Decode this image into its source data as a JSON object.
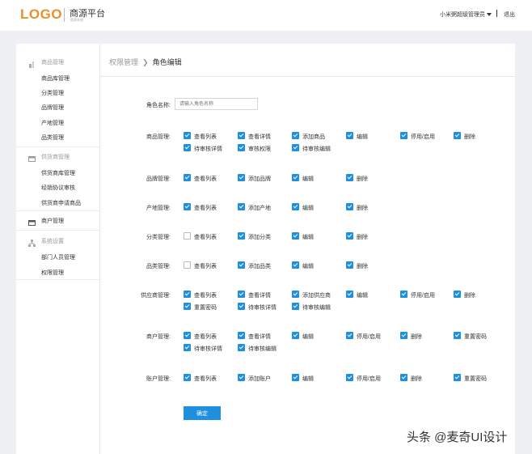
{
  "header": {
    "logo": "LOGO",
    "platform_title": "商源平台",
    "platform_subtitle": "商源系统",
    "user": "小米粥超级管理员",
    "logout": "退出"
  },
  "sidebar": {
    "groups": [
      {
        "label": "商品管理",
        "icon": "goods-icon",
        "items": [
          "商品库管理",
          "分类管理",
          "品牌管理",
          "产地管理",
          "品类管理"
        ]
      },
      {
        "label": "供货商管理",
        "icon": "supplier-icon",
        "items": [
          "供货商库管理",
          "经销协议审核",
          "供货商申请商品"
        ]
      },
      {
        "label": "商户管理",
        "icon": "merchant-icon",
        "items": []
      },
      {
        "label": "系统设置",
        "icon": "org-icon",
        "items": [
          "部门人员管理",
          "权限管理"
        ]
      }
    ]
  },
  "breadcrumb": {
    "parent": "权限管理",
    "current": "角色编辑"
  },
  "form": {
    "role_name_label": "角色名称:",
    "role_name_placeholder": "请输入角色名称",
    "submit": "确定"
  },
  "permissions": [
    {
      "label": "商品管理:",
      "options": [
        {
          "text": "查看列表",
          "checked": true
        },
        {
          "text": "查看详情",
          "checked": true
        },
        {
          "text": "添加商品",
          "checked": true
        },
        {
          "text": "编辑",
          "checked": true
        },
        {
          "text": "停用/启用",
          "checked": true
        },
        {
          "text": "删除",
          "checked": true
        },
        {
          "text": "待审核详情",
          "checked": true
        },
        {
          "text": "审核权限",
          "checked": true
        },
        {
          "text": "待审核编辑",
          "checked": true
        }
      ]
    },
    {
      "label": "品牌管理:",
      "options": [
        {
          "text": "查看列表",
          "checked": true
        },
        {
          "text": "添加品牌",
          "checked": true
        },
        {
          "text": "编辑",
          "checked": true
        },
        {
          "text": "删除",
          "checked": true
        }
      ]
    },
    {
      "label": "产地管理:",
      "options": [
        {
          "text": "查看列表",
          "checked": true
        },
        {
          "text": "添加产地",
          "checked": true
        },
        {
          "text": "编辑",
          "checked": true
        },
        {
          "text": "删除",
          "checked": true
        }
      ]
    },
    {
      "label": "分类管理:",
      "options": [
        {
          "text": "查看列表",
          "checked": false
        },
        {
          "text": "添加分类",
          "checked": true
        },
        {
          "text": "编辑",
          "checked": true
        },
        {
          "text": "删除",
          "checked": true
        }
      ]
    },
    {
      "label": "品类管理:",
      "options": [
        {
          "text": "查看列表",
          "checked": false
        },
        {
          "text": "添加品类",
          "checked": true
        },
        {
          "text": "编辑",
          "checked": true
        },
        {
          "text": "删除",
          "checked": true
        }
      ]
    },
    {
      "label": "供应商管理:",
      "options": [
        {
          "text": "查看列表",
          "checked": true
        },
        {
          "text": "查看详情",
          "checked": true
        },
        {
          "text": "添加供应商",
          "checked": true
        },
        {
          "text": "编辑",
          "checked": true
        },
        {
          "text": "停用/启用",
          "checked": true
        },
        {
          "text": "删除",
          "checked": true
        },
        {
          "text": "重置密码",
          "checked": true
        },
        {
          "text": "待审核详情",
          "checked": true
        },
        {
          "text": "待审核编辑",
          "checked": true
        }
      ]
    },
    {
      "label": "商户管理:",
      "options": [
        {
          "text": "查看列表",
          "checked": true
        },
        {
          "text": "查看详情",
          "checked": true
        },
        {
          "text": "编辑",
          "checked": true
        },
        {
          "text": "停用/启用",
          "checked": true
        },
        {
          "text": "删除",
          "checked": true
        },
        {
          "text": "重置密码",
          "checked": true
        },
        {
          "text": "待审核详情",
          "checked": true
        },
        {
          "text": "待审核编辑",
          "checked": true
        }
      ]
    },
    {
      "label": "账户管理:",
      "options": [
        {
          "text": "查看列表",
          "checked": true
        },
        {
          "text": "添加账户",
          "checked": true
        },
        {
          "text": "编辑",
          "checked": true
        },
        {
          "text": "停用/启用",
          "checked": true
        },
        {
          "text": "删除",
          "checked": true
        },
        {
          "text": "重置密码",
          "checked": true
        }
      ]
    }
  ],
  "watermark": "头条 @麦奇UI设计",
  "colors": {
    "accent": "#1f8fe0",
    "logo": "#e8902a"
  }
}
